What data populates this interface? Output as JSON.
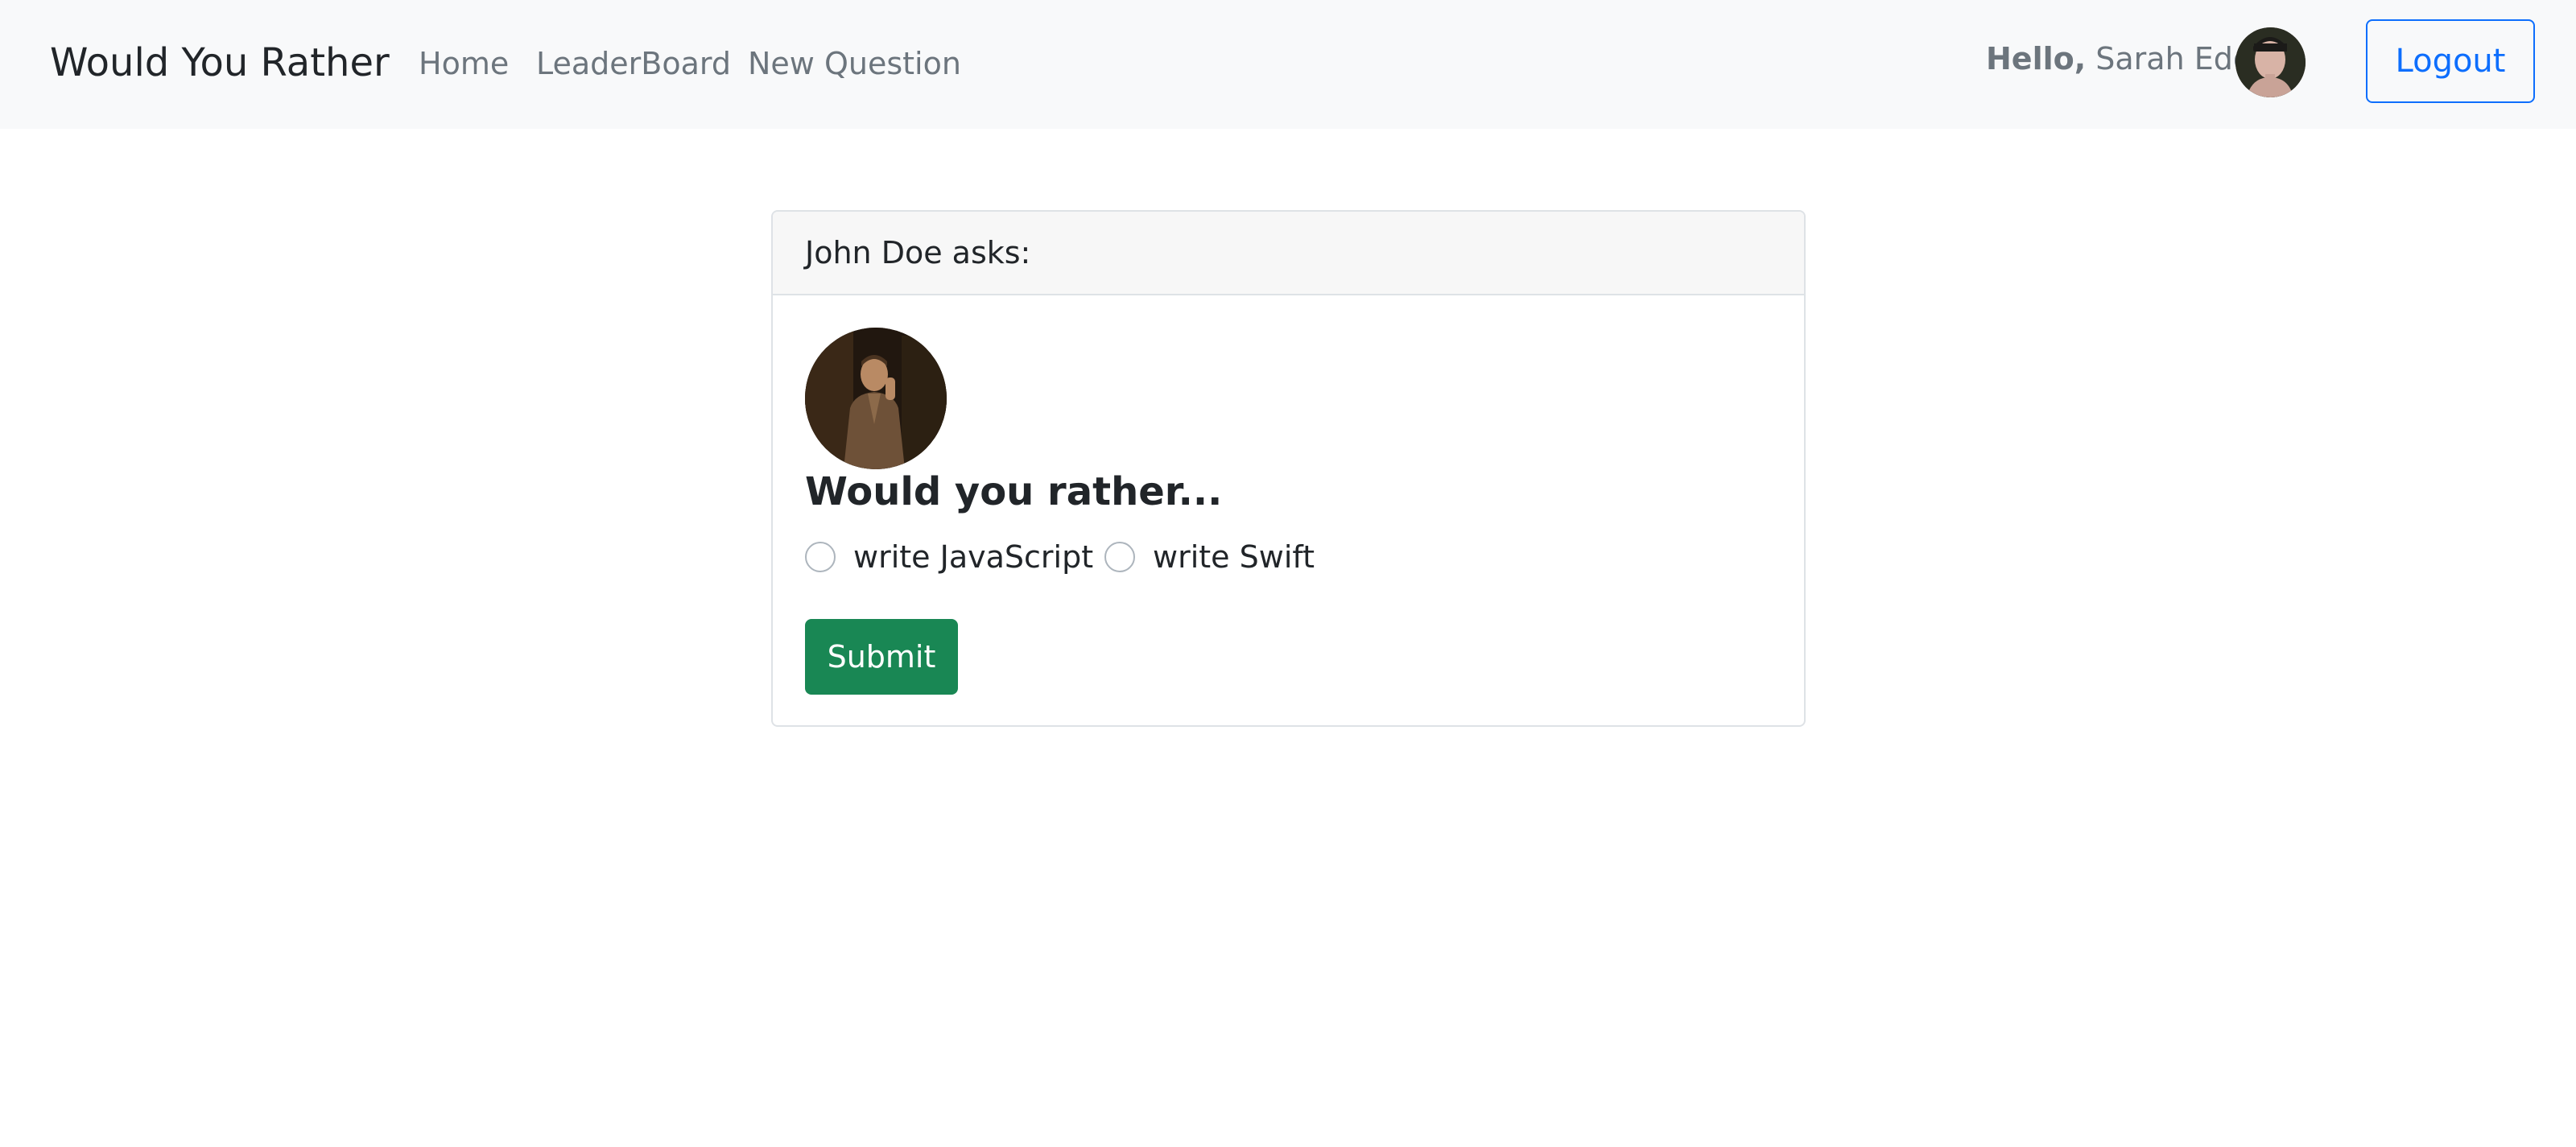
{
  "navbar": {
    "brand": "Would You Rather",
    "links": [
      {
        "label": "Home"
      },
      {
        "label": "LeaderBoard"
      },
      {
        "label": "New Question"
      }
    ],
    "greeting_prefix": "Hello,",
    "user_name": "Sarah Edo",
    "logout_label": "Logout"
  },
  "question": {
    "author_heading": "John Doe asks:",
    "title": "Would you rather...",
    "options": [
      {
        "label": "write JavaScript",
        "selected": false
      },
      {
        "label": "write Swift",
        "selected": false
      }
    ],
    "submit_label": "Submit"
  },
  "colors": {
    "navbar_bg": "#f8f9fa",
    "link": "#6c757d",
    "primary": "#0d6efd",
    "success": "#198754",
    "card_border": "#dee2e6",
    "card_header_bg": "#f7f7f7"
  },
  "icons": {
    "user_avatar": "user-avatar-photo",
    "author_avatar": "author-avatar-photo"
  }
}
